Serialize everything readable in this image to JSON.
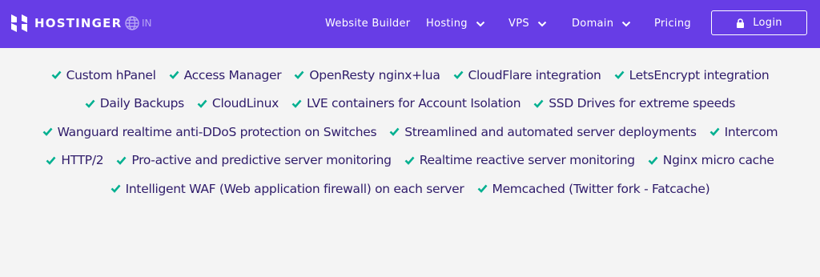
{
  "brand": {
    "name": "HOSTINGER",
    "lang": "IN"
  },
  "nav": {
    "items": [
      {
        "label": "Website Builder",
        "dropdown": false
      },
      {
        "label": "Hosting",
        "dropdown": true
      },
      {
        "label": "VPS",
        "dropdown": true
      },
      {
        "label": "Domain",
        "dropdown": true
      },
      {
        "label": "Pricing",
        "dropdown": false
      }
    ],
    "login_label": "Login"
  },
  "colors": {
    "nav_bg": "#673de6",
    "check": "#00b090",
    "text": "#2f1c6a",
    "page_bg": "#f4f4f4"
  },
  "features": {
    "rows": [
      [
        "Custom hPanel",
        "Access Manager",
        "OpenResty nginx+lua",
        "CloudFlare integration",
        "LetsEncrypt integration"
      ],
      [
        "Daily Backups",
        "CloudLinux",
        "LVE containers for Account Isolation",
        "SSD Drives for extreme speeds"
      ],
      [
        "Wanguard realtime anti-DDoS protection on Switches",
        "Streamlined and automated server deployments",
        "Intercom"
      ],
      [
        "HTTP/2",
        "Pro-active and predictive server monitoring",
        "Realtime reactive server monitoring",
        "Nginx micro cache"
      ],
      [
        "Intelligent WAF (Web application firewall) on each server",
        "Memcached (Twitter fork - Fatcache)"
      ]
    ]
  }
}
